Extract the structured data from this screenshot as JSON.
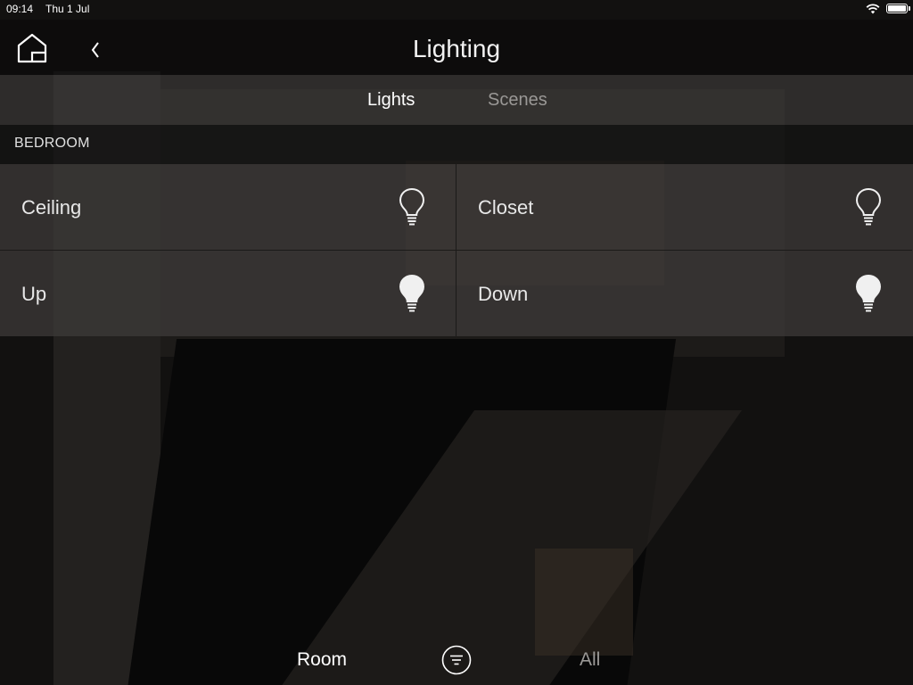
{
  "status_bar": {
    "time": "09:14",
    "date": "Thu 1 Jul"
  },
  "header": {
    "title": "Lighting",
    "home_icon": "home-icon",
    "back_icon": "chevron-left-icon"
  },
  "tabs": [
    {
      "label": "Lights",
      "active": true
    },
    {
      "label": "Scenes",
      "active": false
    }
  ],
  "section": {
    "label": "BEDROOM"
  },
  "lights": [
    {
      "label": "Ceiling",
      "state": "off",
      "icon": "lightbulb-outline-icon"
    },
    {
      "label": "Closet",
      "state": "off",
      "icon": "lightbulb-outline-icon"
    },
    {
      "label": "Up",
      "state": "on",
      "icon": "lightbulb-filled-icon"
    },
    {
      "label": "Down",
      "state": "on",
      "icon": "lightbulb-filled-icon"
    }
  ],
  "bottom_bar": {
    "room_label": "Room",
    "filter_icon": "filter-icon",
    "all_label": "All"
  },
  "colors": {
    "text_active": "#ffffff",
    "text_inactive": "#9a9896",
    "tile_background": "#3e3c3a"
  }
}
